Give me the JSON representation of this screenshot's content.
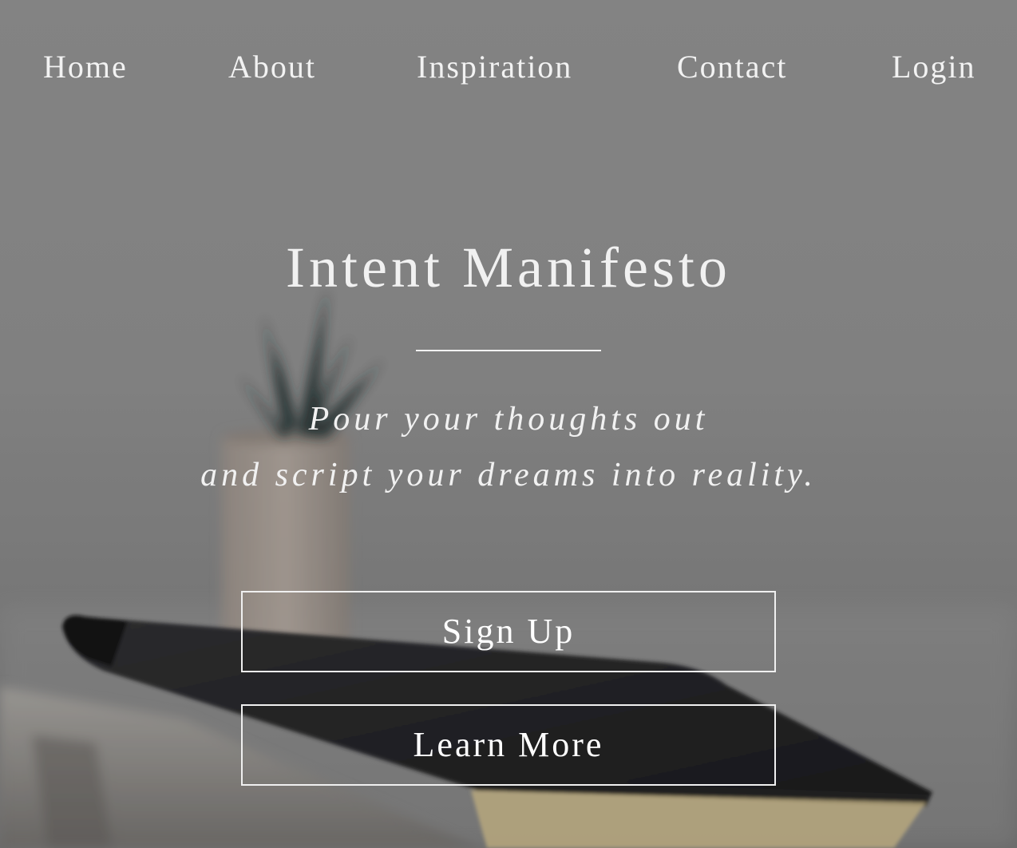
{
  "nav": {
    "items": [
      {
        "label": "Home"
      },
      {
        "label": "About"
      },
      {
        "label": "Inspiration"
      },
      {
        "label": "Contact"
      },
      {
        "label": "Login"
      }
    ]
  },
  "hero": {
    "title": "Intent Manifesto",
    "tagline_line1": "Pour your thoughts out",
    "tagline_line2": "and script your dreams into reality."
  },
  "buttons": {
    "signup_label": "Sign Up",
    "learn_more_label": "Learn More"
  },
  "colors": {
    "text": "#ffffff",
    "background_gray": "#8c8c8c",
    "notebook": "#1c1c1e"
  }
}
